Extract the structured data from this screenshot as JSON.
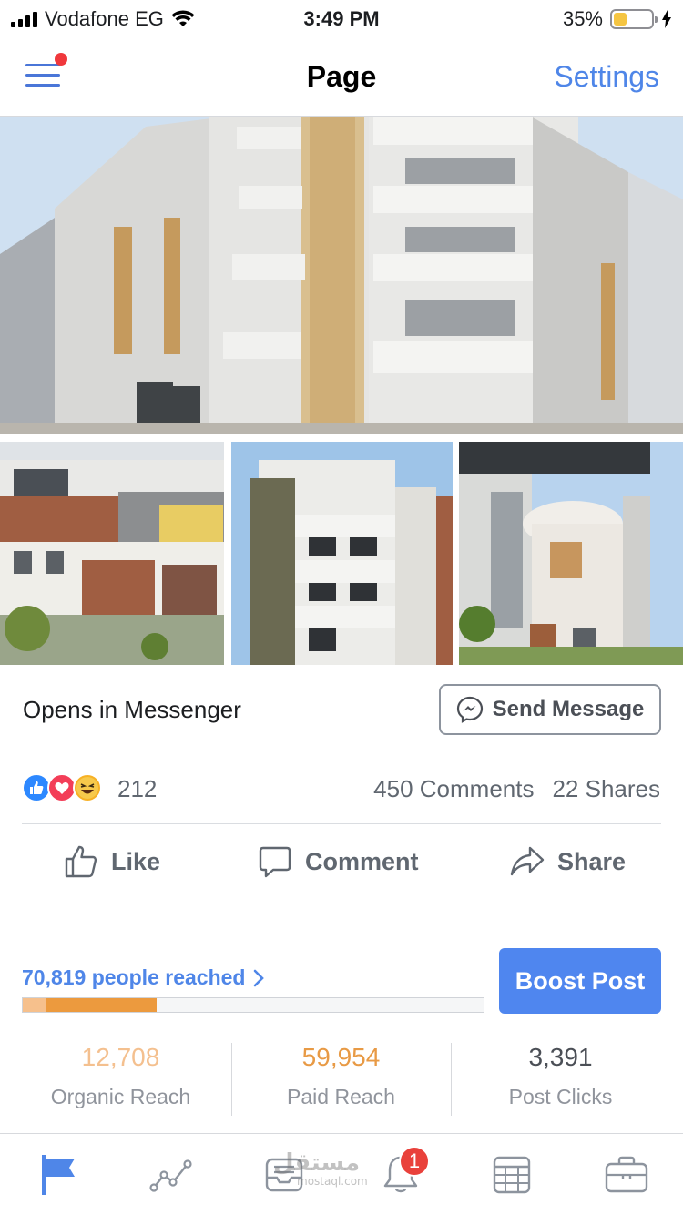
{
  "status_bar": {
    "carrier": "Vodafone EG",
    "time": "3:49 PM",
    "battery_percent": "35%",
    "battery_level": 0.35
  },
  "nav": {
    "title": "Page",
    "settings_label": "Settings",
    "menu_has_notification": true
  },
  "post": {
    "messenger_text": "Opens in Messenger",
    "send_message_label": "Send Message",
    "reactions_count": "212",
    "comments_text": "450 Comments",
    "shares_text": "22 Shares",
    "actions": {
      "like": "Like",
      "comment": "Comment",
      "share": "Share"
    }
  },
  "insights": {
    "people_reached": "70,819 people reached",
    "boost_label": "Boost Post",
    "organic_fraction": 0.05,
    "paid_fraction": 0.24,
    "stats": [
      {
        "value": "12,708",
        "label": "Organic Reach"
      },
      {
        "value": "59,954",
        "label": "Paid Reach"
      },
      {
        "value": "3,391",
        "label": "Post Clicks"
      }
    ]
  },
  "tab_bar": {
    "tabs": [
      "flag-icon",
      "insights-icon",
      "inbox-icon",
      "notifications-icon",
      "calendar-icon",
      "briefcase-icon"
    ],
    "notification_badge": "1"
  },
  "watermark": {
    "text": "مستقل",
    "sub": "mostaql.com"
  },
  "colors": {
    "accent": "#4f86e8",
    "boost": "#4f86ef",
    "organic": "#f6c08c",
    "paid": "#ec9a3e",
    "badge": "#e9413b"
  }
}
